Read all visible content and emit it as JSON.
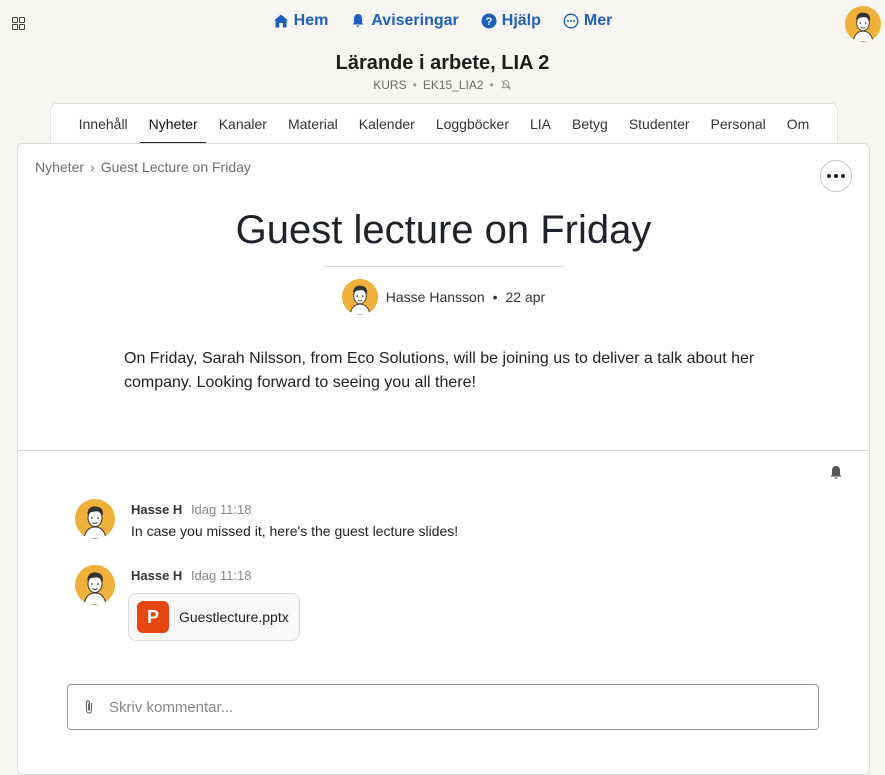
{
  "nav": {
    "items": [
      {
        "label": "Hem",
        "icon": "home-icon"
      },
      {
        "label": "Aviseringar",
        "icon": "bell-icon"
      },
      {
        "label": "Hjälp",
        "icon": "help-icon"
      },
      {
        "label": "Mer",
        "icon": "more-circle-icon"
      }
    ]
  },
  "course": {
    "title": "Lärande i arbete, LIA 2",
    "kind": "KURS",
    "code": "EK15_LIA2"
  },
  "tabs": [
    "Innehåll",
    "Nyheter",
    "Kanaler",
    "Material",
    "Kalender",
    "Loggböcker",
    "LIA",
    "Betyg",
    "Studenter",
    "Personal",
    "Om"
  ],
  "active_tab": "Nyheter",
  "breadcrumb": {
    "parent": "Nyheter",
    "sep": "›",
    "current": "Guest Lecture on Friday"
  },
  "post": {
    "title": "Guest lecture on Friday",
    "author": "Hasse Hansson",
    "date": "22 apr",
    "body": "On Friday, Sarah Nilsson, from Eco Solutions, will be joining us to deliver a talk about her company. Looking forward to seeing you all there!"
  },
  "comments": [
    {
      "author": "Hasse H",
      "time": "Idag 11:18",
      "text": "In case you missed it, here's the guest lecture slides!"
    },
    {
      "author": "Hasse H",
      "time": "Idag 11:18",
      "attachment": {
        "icon_letter": "P",
        "name": "Guestlecture.pptx"
      }
    }
  ],
  "comment_input": {
    "placeholder": "Skriv kommentar..."
  },
  "colors": {
    "accent": "#1f5fbf",
    "avatar_bg": "#f0b13b",
    "pptx": "#e8450f"
  }
}
